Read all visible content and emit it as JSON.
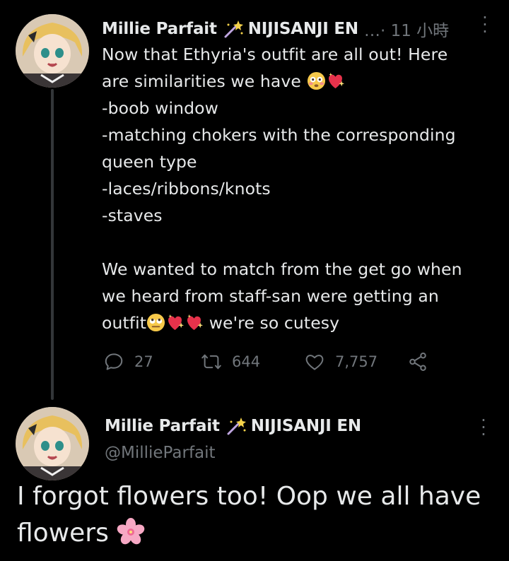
{
  "tweet": {
    "author_name": "Millie Parfait",
    "author_suffix": "NIJISANJI EN",
    "meta": "…· 11 小時",
    "lines": [
      "Now that Ethyria's outfit are all out! Here",
      "are similarities we have",
      "-boob window",
      "-matching chokers with the corresponding",
      "queen type",
      "-laces/ribbons/knots",
      "-staves",
      "",
      "We wanted to match from the get go when",
      "we heard from staff-san were getting an",
      "outfit",
      "we're so cutesy"
    ],
    "actions": {
      "reply_count": "27",
      "retweet_count": "644",
      "like_count": "7,757"
    },
    "icons": [
      "wand-icon",
      "flushed-emoji-icon",
      "sparkling-heart-icon",
      "eye-roll-emoji-icon",
      "reply-icon",
      "retweet-icon",
      "like-icon",
      "share-icon",
      "more-icon"
    ]
  },
  "reply": {
    "author_name": "Millie Parfait",
    "author_suffix": "NIJISANJI EN",
    "handle": "@MillieParfait",
    "text": "I forgot flowers too! Oop we all have flowers",
    "icons": [
      "wand-icon",
      "cherry-blossom-icon",
      "more-icon"
    ]
  },
  "colors": {
    "background": "#000000",
    "text": "#e7e9ea",
    "muted": "#71767b",
    "thread_line": "#333639"
  }
}
